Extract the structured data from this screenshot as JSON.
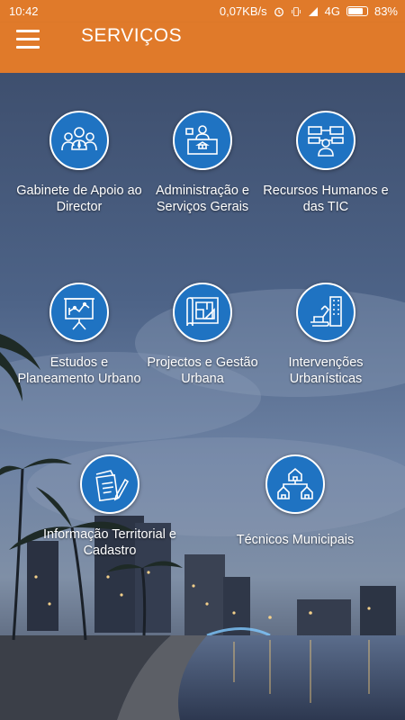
{
  "status_bar": {
    "time": "10:42",
    "network_speed": "0,07KB/s",
    "network_type": "4G",
    "battery_percent_label": "83%",
    "battery_level": 0.83
  },
  "app_bar": {
    "title": "SERVIÇOS",
    "menu_icon": "hamburger-menu-icon"
  },
  "colors": {
    "accent": "#e07a2a",
    "icon_circle": "#1f73c2"
  },
  "services": [
    {
      "label": "Gabinete de Apoio ao Director",
      "icon": "group-people-icon"
    },
    {
      "label": "Administração e Serviços Gerais",
      "icon": "reception-desk-icon"
    },
    {
      "label": "Recursos Humanos e das TIC",
      "icon": "network-person-icon"
    },
    {
      "label": "Estudos e Planeamento Urbano",
      "icon": "presentation-board-icon"
    },
    {
      "label": "Projectos e Gestão Urbana",
      "icon": "blueprint-icon"
    },
    {
      "label": "Intervenções Urbanísticas",
      "icon": "excavator-building-icon"
    },
    {
      "label": "Informação Territorial e Cadastro",
      "icon": "documents-pen-icon"
    },
    {
      "label": "Técnicos Municipais",
      "icon": "houses-hierarchy-icon"
    }
  ]
}
